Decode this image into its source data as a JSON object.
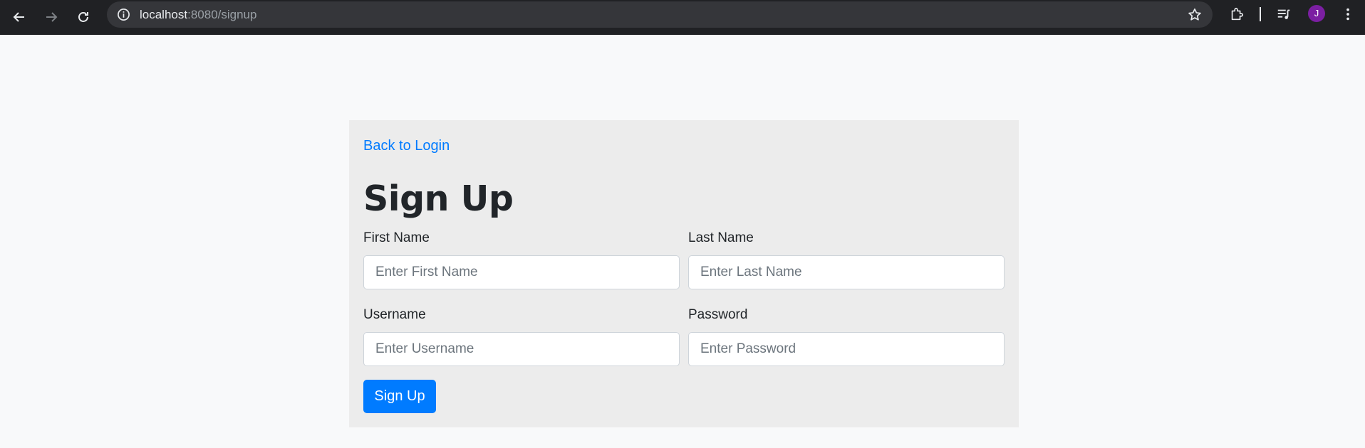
{
  "browser": {
    "url_host": "localhost",
    "url_path": ":8080/signup",
    "profile_initial": "J",
    "profile_color": "#7b1fa2"
  },
  "page": {
    "back_link": "Back to Login",
    "title": "Sign Up",
    "fields": {
      "first_name": {
        "label": "First Name",
        "placeholder": "Enter First Name",
        "value": ""
      },
      "last_name": {
        "label": "Last Name",
        "placeholder": "Enter Last Name",
        "value": ""
      },
      "username": {
        "label": "Username",
        "placeholder": "Enter Username",
        "value": ""
      },
      "password": {
        "label": "Password",
        "placeholder": "Enter Password",
        "value": ""
      }
    },
    "submit_label": "Sign Up"
  },
  "colors": {
    "accent": "#007bff",
    "card_bg": "#ececec",
    "page_bg": "#f8f9fa"
  }
}
